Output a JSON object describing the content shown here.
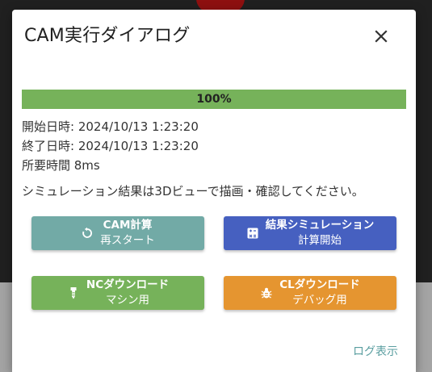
{
  "dialog": {
    "title": "CAM実行ダイアログ",
    "close_icon": "close-icon"
  },
  "progress": {
    "value": 100,
    "label": "100%",
    "color": "#76b25a"
  },
  "info": {
    "start": "開始日時: 2024/10/13 1:23:20",
    "end": "終了日時: 2024/10/13 1:23:20",
    "duration": "所要時間 8ms",
    "message": "シミュレーション結果は3Dビューで描画・確認してください。"
  },
  "buttons": [
    {
      "line1": "CAM計算",
      "line2": "再スタート",
      "icon": "restart-icon",
      "color": "#72aaa6"
    },
    {
      "line1": "結果シミュレーション",
      "line2": "計算開始",
      "icon": "calculator-icon",
      "color": "#4660c0"
    },
    {
      "line1": "NCダウンロード",
      "line2": "マシン用",
      "icon": "tool-icon",
      "color": "#76b25a"
    },
    {
      "line1": "CLダウンロード",
      "line2": "デバッグ用",
      "icon": "bug-icon",
      "color": "#e59530"
    }
  ],
  "log_link": "ログ表示"
}
